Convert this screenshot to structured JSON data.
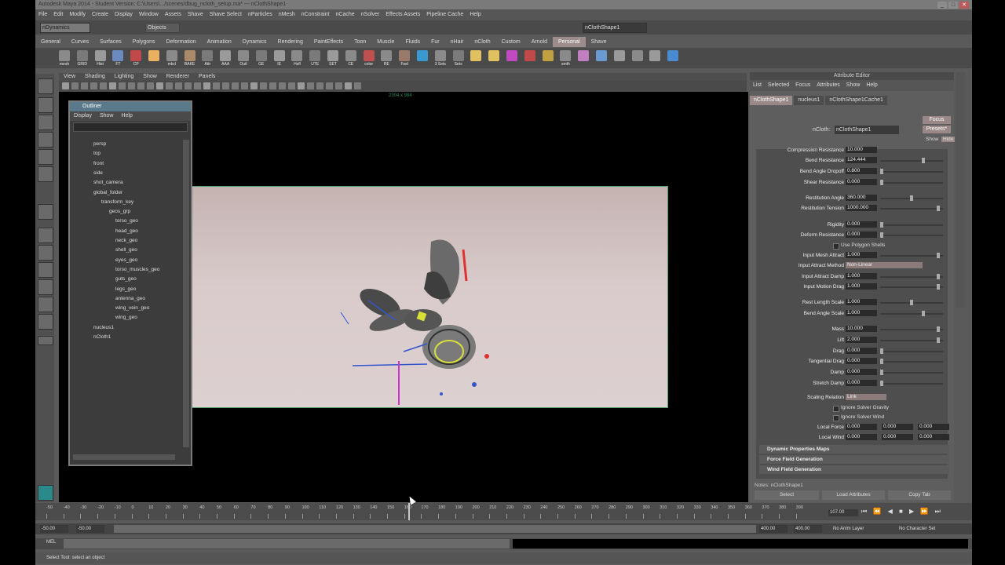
{
  "title": "Autodesk Maya 2014 - Student Version: C:\\Users\\.../scenes/dbug_ncloth_setup.ma* --- nClothShape1",
  "menu": [
    "File",
    "Edit",
    "Modify",
    "Create",
    "Display",
    "Window",
    "Assets",
    "Shave",
    "Shave Select",
    "nParticles",
    "nMesh",
    "nConstraint",
    "nCache",
    "nSolver",
    "Effects Assets",
    "Pipeline Cache",
    "Help"
  ],
  "status": {
    "menu_set": "nDynamics",
    "objects": "Objects",
    "field": "nClothShape1"
  },
  "shelf_tabs": [
    "General",
    "Curves",
    "Surfaces",
    "Polygons",
    "Deformation",
    "Animation",
    "Dynamics",
    "Rendering",
    "PaintEffects",
    "Toon",
    "Muscle",
    "Fluids",
    "Fur",
    "nHair",
    "nCloth",
    "Custom",
    "Arnold",
    "Personal",
    "Shave"
  ],
  "shelf_active": "Personal",
  "shelf_labels": [
    "mesh",
    "GRID",
    "Hist",
    "FT",
    "CP",
    "",
    "mkcl",
    "BAKE",
    "Attr",
    "AAA",
    "Outl",
    "GE",
    "IE",
    "Hsfl",
    "UTE",
    "SET",
    "CE",
    "color",
    "RE",
    "Fwd",
    "",
    "3 Sets",
    "Sets",
    "",
    "",
    "",
    "",
    "",
    "smth",
    "",
    "",
    "",
    "",
    "",
    ""
  ],
  "panel_menu": [
    "View",
    "Shading",
    "Lighting",
    "Show",
    "Renderer",
    "Panels"
  ],
  "resolution": "2304 x 984",
  "outliner": {
    "title": "Outliner",
    "menu": [
      "Display",
      "Show",
      "Help"
    ],
    "items": [
      "persp",
      "top",
      "front",
      "side",
      "shot_camera",
      "global_folder",
      "transform_key",
      "geos_grp",
      "torso_geo",
      "head_geo",
      "neck_geo",
      "shell_geo",
      "eyes_geo",
      "torso_muscles_geo",
      "guts_geo",
      "legs_geo",
      "antenna_geo",
      "wing_vein_geo",
      "wing_geo",
      "nucleus1",
      "nCloth1"
    ]
  },
  "ae": {
    "header": "Attribute Editor",
    "menu": [
      "List",
      "Selected",
      "Focus",
      "Attributes",
      "Show",
      "Help"
    ],
    "tabs": [
      "nClothShape1",
      "nucleus1",
      "nClothShape1Cache1"
    ],
    "ncloth_label": "nCloth:",
    "ncloth_value": "nClothShape1",
    "focus": "Focus",
    "presets": "Presets*",
    "show": "Show",
    "hide": "Hide",
    "attrs": [
      {
        "label": "Compression Resistance",
        "value": "10.000"
      },
      {
        "label": "Bend Resistance",
        "value": "124.444"
      },
      {
        "label": "Bend Angle Dropoff",
        "value": "0.800"
      },
      {
        "label": "Shear Resistance",
        "value": "0.000"
      },
      {
        "label": "Restitution Angle",
        "value": "360.000"
      },
      {
        "label": "Restitution Tension",
        "value": "1000.000"
      },
      {
        "label": "Rigidity",
        "value": "0.000"
      },
      {
        "label": "Deform Resistance",
        "value": "0.000"
      },
      {
        "label": "Input Mesh Attract",
        "value": "1.000"
      },
      {
        "label": "Input Attract Method",
        "value": "Non-Linear"
      },
      {
        "label": "Input Attract Damp",
        "value": "1.000"
      },
      {
        "label": "Input Motion Drag",
        "value": "1.000"
      },
      {
        "label": "Rest Length Scale",
        "value": "1.000"
      },
      {
        "label": "Bend Angle Scale",
        "value": "1.000"
      },
      {
        "label": "Mass",
        "value": "10.000"
      },
      {
        "label": "Lift",
        "value": "2.000"
      },
      {
        "label": "Drag",
        "value": "0.000"
      },
      {
        "label": "Tangential Drag",
        "value": "0.000"
      },
      {
        "label": "Damp",
        "value": "0.000"
      },
      {
        "label": "Stretch Damp",
        "value": "0.000"
      }
    ],
    "use_polygon_shells": "Use Polygon Shells",
    "scaling_relation": {
      "label": "Scaling Relation",
      "value": "Link"
    },
    "ignore_gravity": "Ignore Solver Gravity",
    "ignore_wind": "Ignore Solver Wind",
    "local_force": {
      "label": "Local Force",
      "values": [
        "0.000",
        "0.000",
        "0.000"
      ]
    },
    "local_wind": {
      "label": "Local Wind",
      "values": [
        "0.000",
        "0.000",
        "0.000"
      ]
    },
    "sections": [
      "Dynamic Properties Maps",
      "Force Field Generation",
      "Wind Field Generation"
    ],
    "notes": "Notes: nClothShape1",
    "buttons": [
      "Select",
      "Load Attributes",
      "Copy Tab"
    ]
  },
  "timeline": {
    "ticks": [
      "-50",
      "-40",
      "-30",
      "-20",
      "-10",
      "0",
      "10",
      "20",
      "30",
      "40",
      "50",
      "60",
      "70",
      "80",
      "90",
      "100",
      "110",
      "120",
      "130",
      "140",
      "150",
      "160",
      "170",
      "180",
      "190",
      "200",
      "210",
      "220",
      "230",
      "240",
      "250",
      "260",
      "270",
      "280",
      "290",
      "300",
      "310",
      "320",
      "330",
      "340",
      "350",
      "360",
      "370",
      "380",
      "390"
    ],
    "current": "107.00",
    "range_start": "-50.00",
    "range_inner": "-50.00",
    "range_end": "400.00",
    "range_end2": "400.00",
    "anim_layer": "No Anim Layer",
    "char_set": "No Character Set"
  },
  "cmd_label": "MEL",
  "help_text": "Select Tool: select an object"
}
